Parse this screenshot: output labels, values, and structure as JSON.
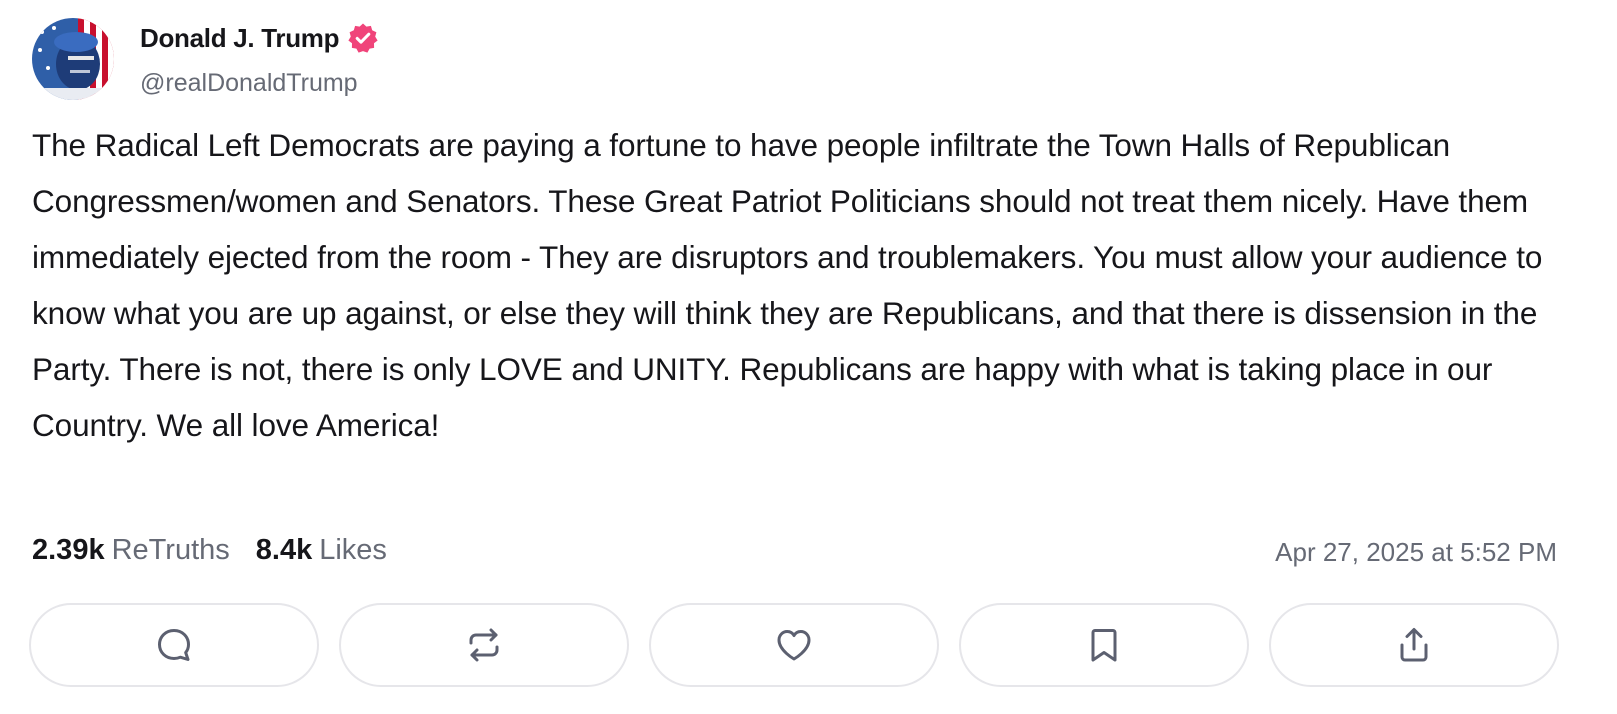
{
  "author": {
    "name": "Donald J. Trump",
    "handle": "@realDonaldTrump",
    "verified": true,
    "avatar_icon": "profile-avatar",
    "verified_icon": "verified-badge-icon"
  },
  "post": {
    "text": "The Radical Left Democrats are paying a fortune to have people infiltrate the Town Halls of Republican Congressmen/women and Senators. These Great Patriot Politicians should not treat them nicely. Have them immediately ejected from the room - They are disruptors and troublemakers. You must allow your audience to know what you are up against, or else they will think they are Republicans, and that there is dissension in the Party. There is not, there is only LOVE and UNITY. Republicans are happy with what is taking place in our Country. We all love America!"
  },
  "stats": {
    "retruths_count": "2.39k",
    "retruths_label": "ReTruths",
    "likes_count": "8.4k",
    "likes_label": "Likes"
  },
  "timestamp": "Apr 27, 2025 at 5:52 PM",
  "actions": [
    {
      "name": "reply",
      "icon": "comment-icon"
    },
    {
      "name": "retruth",
      "icon": "repost-icon"
    },
    {
      "name": "like",
      "icon": "heart-icon"
    },
    {
      "name": "bookmark",
      "icon": "bookmark-icon"
    },
    {
      "name": "share",
      "icon": "share-icon"
    }
  ],
  "colors": {
    "verified_badge": "#f0447a",
    "text_primary": "#16161a",
    "text_secondary": "#666a75",
    "button_border": "#e6e6ea",
    "icon_color": "#5c6070"
  }
}
